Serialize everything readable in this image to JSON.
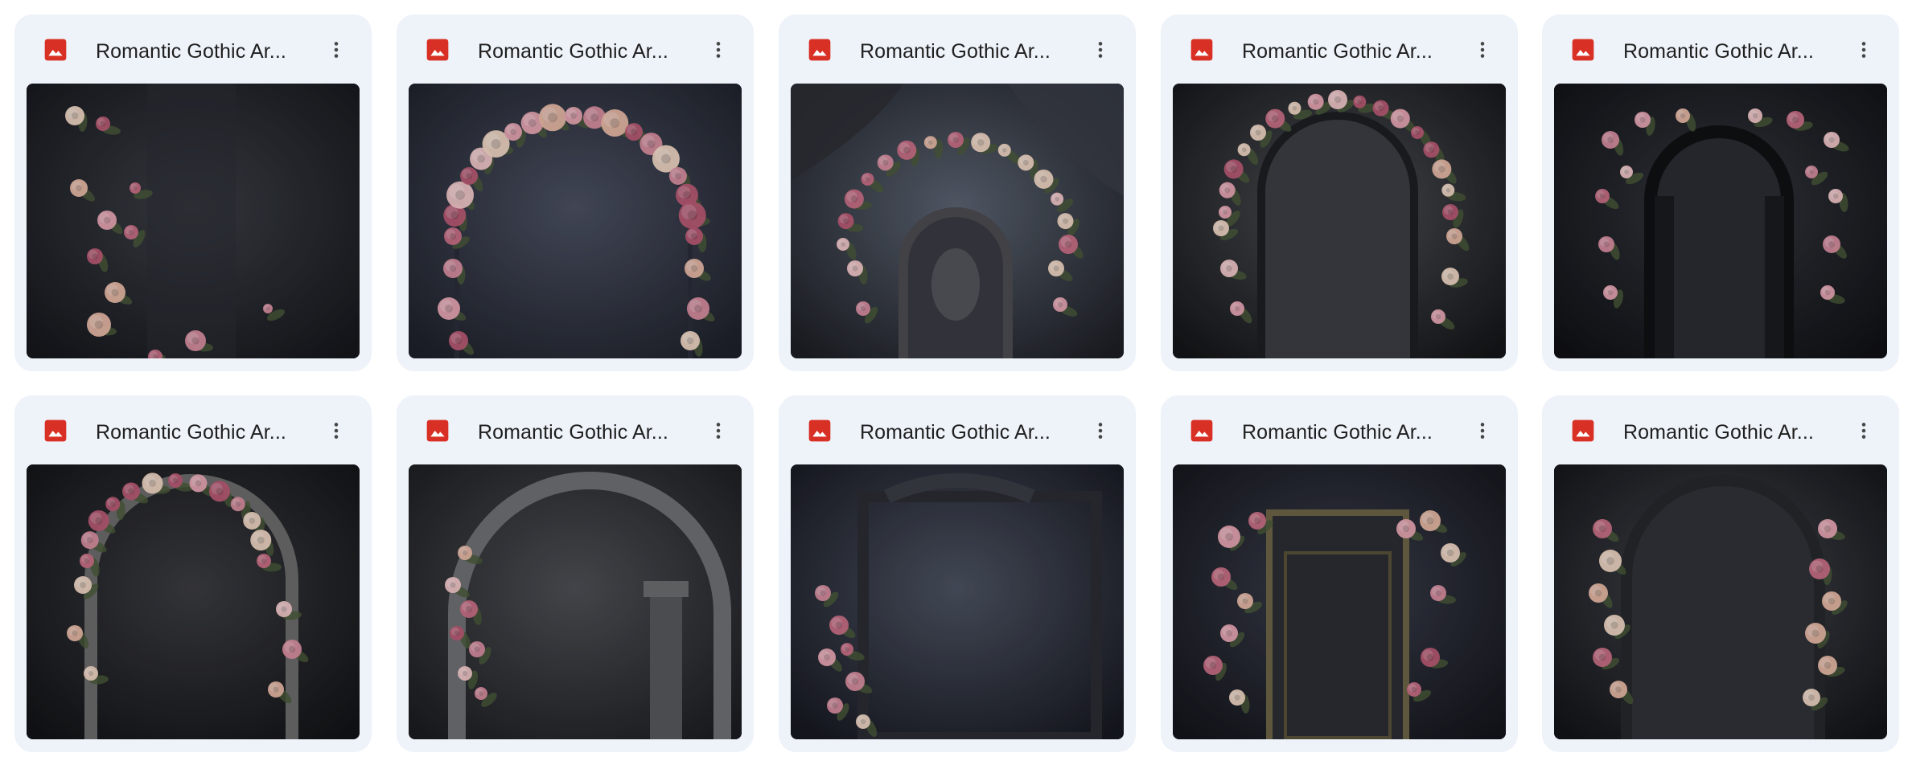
{
  "files": [
    {
      "name": "Romantic Gothic Ar...",
      "type_icon": "image-file-icon",
      "preview": "roses-left-vine"
    },
    {
      "name": "Romantic Gothic Ar...",
      "type_icon": "image-file-icon",
      "preview": "flower-arch"
    },
    {
      "name": "Romantic Gothic Ar...",
      "type_icon": "image-file-icon",
      "preview": "drape-arch-statue"
    },
    {
      "name": "Romantic Gothic Ar...",
      "type_icon": "image-file-icon",
      "preview": "vine-arch-door"
    },
    {
      "name": "Romantic Gothic Ar...",
      "type_icon": "image-file-icon",
      "preview": "carved-door-roses"
    },
    {
      "name": "Romantic Gothic Ar...",
      "type_icon": "image-file-icon",
      "preview": "stone-arch-roses"
    },
    {
      "name": "Romantic Gothic Ar...",
      "type_icon": "image-file-icon",
      "preview": "plain-stone-arch"
    },
    {
      "name": "Romantic Gothic Ar...",
      "type_icon": "image-file-icon",
      "preview": "ornate-frame-roses"
    },
    {
      "name": "Romantic Gothic Ar...",
      "type_icon": "image-file-icon",
      "preview": "gold-door-roses"
    },
    {
      "name": "Romantic Gothic Ar...",
      "type_icon": "image-file-icon",
      "preview": "dark-arch-roses"
    }
  ],
  "colors": {
    "card_bg": "#eef2f9",
    "image_icon_red": "#d93025",
    "title_text": "#1f1f1f",
    "more_icon": "#444746"
  },
  "icons": {
    "file_type": "image-file-icon",
    "more": "more-vert-icon"
  }
}
